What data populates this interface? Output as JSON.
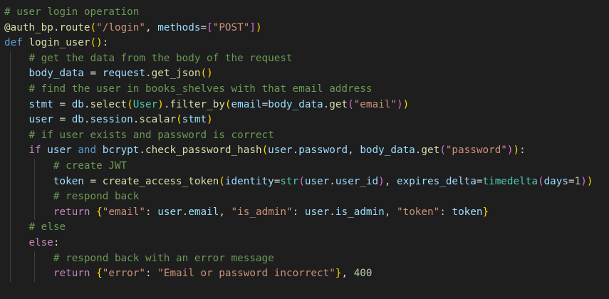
{
  "code": {
    "l1": [
      "# user login operation"
    ],
    "l2": [
      "@auth_bp",
      ".",
      "route",
      "(",
      "\"/login\"",
      ", ",
      "methods",
      "=",
      "[",
      "\"POST\"",
      "]",
      ")"
    ],
    "l3": [
      "def",
      " ",
      "login_user",
      "(",
      ")",
      ":"
    ],
    "l4": [
      "# get the data from the body of the request"
    ],
    "l5": [
      "body_data",
      " = ",
      "request",
      ".",
      "get_json",
      "(",
      ")"
    ],
    "l6": [
      "# find the user in books_shelves with that email address"
    ],
    "l7": [
      "stmt",
      " = ",
      "db",
      ".",
      "select",
      "(",
      "User",
      ")",
      ".",
      "filter_by",
      "(",
      "email",
      "=",
      "body_data",
      ".",
      "get",
      "(",
      "\"email\"",
      ")",
      ")"
    ],
    "l8": [
      "user",
      " = ",
      "db",
      ".",
      "session",
      ".",
      "scalar",
      "(",
      "stmt",
      ")"
    ],
    "l9": [
      "# if user exists and password is correct"
    ],
    "l10": [
      "if",
      " ",
      "user",
      " ",
      "and",
      " ",
      "bcrypt",
      ".",
      "check_password_hash",
      "(",
      "user",
      ".",
      "password",
      ", ",
      "body_data",
      ".",
      "get",
      "(",
      "\"password\"",
      ")",
      ")",
      ":"
    ],
    "l11": [
      "# create JWT"
    ],
    "l12": [
      "token",
      " = ",
      "create_access_token",
      "(",
      "identity",
      "=",
      "str",
      "(",
      "user",
      ".",
      "user_id",
      ")",
      ", ",
      "expires_delta",
      "=",
      "timedelta",
      "(",
      "days",
      "=",
      "1",
      ")",
      ")"
    ],
    "l13": [
      "# respond back"
    ],
    "l14": [
      "return",
      " ",
      "{",
      "\"email\"",
      ": ",
      "user",
      ".",
      "email",
      ", ",
      "\"is_admin\"",
      ": ",
      "user",
      ".",
      "is_admin",
      ", ",
      "\"token\"",
      ": ",
      "token",
      "}"
    ],
    "l15": [
      "# else"
    ],
    "l16": [
      "else",
      ":"
    ],
    "l17": [
      "# respond back with an error message"
    ],
    "l18": [
      "return",
      " ",
      "{",
      "\"error\"",
      ": ",
      "\"Email or password incorrect\"",
      "}",
      ", ",
      "400"
    ]
  },
  "theme": {
    "background": "#1e1e1e",
    "comment": "#6a9955",
    "keyword": "#569cd6",
    "control": "#c586c0",
    "function": "#dcdcaa",
    "variable": "#9cdcfe",
    "string": "#ce9178",
    "number": "#b5cea8",
    "class": "#4ec9b0",
    "bracket_level_1": "#ffd700",
    "bracket_level_2": "#da70d6",
    "bracket_level_3": "#179fff"
  }
}
